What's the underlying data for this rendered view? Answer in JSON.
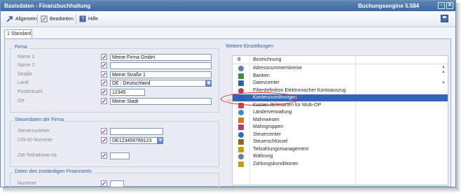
{
  "window": {
    "title": "Basisdaten - Finanzbuchhaltung",
    "right_title": "Buchungsengine 5.584"
  },
  "toolbar": {
    "allgemein": "Allgemein",
    "bearbeiten": "Bearbeiten",
    "hilfe": "Hilfe"
  },
  "tab": {
    "label": "1 Standard"
  },
  "firma": {
    "title": "Firma",
    "fields": [
      {
        "label": "Name 1",
        "value": "Meine Firma GmbH"
      },
      {
        "label": "Name 2",
        "value": ""
      },
      {
        "label": "Straße",
        "value": "Meine Straße 1"
      },
      {
        "label": "Land",
        "value": "DE    : Deutschland"
      },
      {
        "label": "Postleitzahl",
        "value": "12345"
      },
      {
        "label": "Ort",
        "value": "Meine Stadt"
      }
    ]
  },
  "steuer": {
    "title": "Steuerdaten der Firma",
    "fields": [
      {
        "label": "Steuernummer",
        "value": ""
      },
      {
        "label": "USt-ID-Nummer",
        "value": "DE123456789123"
      },
      {
        "label": "ZM-Teilnehmer-Nr.",
        "value": ""
      }
    ]
  },
  "finanzamt": {
    "title": "Daten des zuständigen Finanzamts",
    "fields": [
      {
        "label": "Nummer",
        "value": ""
      }
    ]
  },
  "weitere": {
    "title": "Weitere Einstellungen",
    "col_b": "B",
    "col_bez": "Bezeichnung",
    "items": [
      {
        "label": "Adressnummernkreise",
        "icon": "address-book-icon"
      },
      {
        "label": "Banken",
        "icon": "bank-icon"
      },
      {
        "label": "Datevcenter",
        "icon": "datev-icon"
      },
      {
        "label": "Filterdefinition Elektronischer Kontoauszug",
        "icon": "filter-icon"
      },
      {
        "label": "Kontenzuordnungen",
        "icon": "account-assignment-icon"
      },
      {
        "label": "Kosten-/Erlösarten für Multi-OP",
        "icon": "cost-types-icon"
      },
      {
        "label": "Länderverwaltung",
        "icon": "globe-icon"
      },
      {
        "label": "Mahnwesen",
        "icon": "dunning-icon"
      },
      {
        "label": "Mahngruppen",
        "icon": "dunning-groups-icon"
      },
      {
        "label": "Steuercenter",
        "icon": "tax-center-icon"
      },
      {
        "label": "Steuerschlüssel",
        "icon": "tax-key-icon"
      },
      {
        "label": "Teilzahlungsmanagement",
        "icon": "installment-icon"
      },
      {
        "label": "Währung",
        "icon": "currency-icon"
      },
      {
        "label": "Zahlungskonditionen",
        "icon": "payment-terms-icon"
      }
    ],
    "selected_index": 4
  },
  "colors": {
    "title_bar": "#4a78ad",
    "selection": "#3464b4",
    "group_title": "#2f5fa8",
    "highlight_ellipse": "#d62020"
  }
}
